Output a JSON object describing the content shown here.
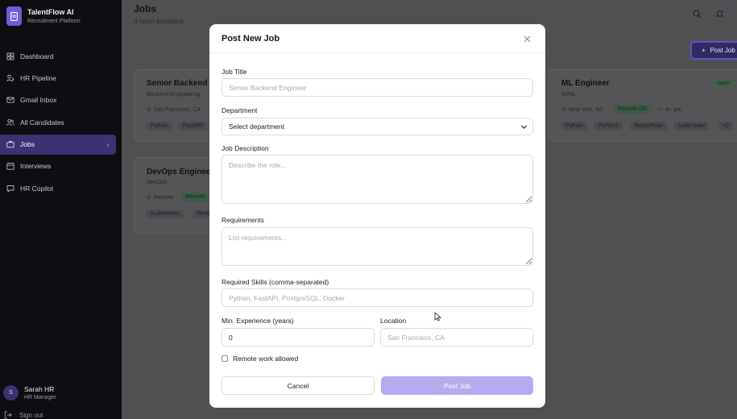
{
  "app": {
    "name": "TalentFlow AI",
    "subtitle": "Recruitment Platform"
  },
  "sidebar": {
    "items": [
      {
        "label": "Dashboard",
        "icon": "dashboard-icon"
      },
      {
        "label": "HR Pipeline",
        "icon": "pipeline-icon"
      },
      {
        "label": "Gmail Inbox",
        "icon": "mail-icon"
      },
      {
        "label": "All Candidates",
        "icon": "users-icon"
      },
      {
        "label": "Jobs",
        "icon": "briefcase-icon",
        "active": true
      },
      {
        "label": "Interviews",
        "icon": "calendar-icon"
      },
      {
        "label": "HR Copilot",
        "icon": "chat-icon"
      }
    ],
    "user": {
      "initial": "S",
      "name": "Sarah HR",
      "role": "HR Manager"
    },
    "signout": "Sign out"
  },
  "header": {
    "title": "Jobs",
    "subtitle": "4 open positions",
    "post_button": "Post Job"
  },
  "jobs": [
    {
      "title": "Senior Backend",
      "dept": "Backend Engineering",
      "location": "San Francisco, CA",
      "tags": [
        "Python",
        "FastAPI"
      ]
    },
    {
      "title": "DevOps Enginee",
      "dept": "DevOps",
      "location": "Remote",
      "remote_badge": "Remote",
      "tags": [
        "Kubernetes",
        "Terra"
      ]
    },
    {
      "title": "ML Engineer",
      "dept": "AI/ML",
      "location": "New York, NY",
      "remote_badge": "Remote OK",
      "experience": "4+ yrs",
      "status": "open",
      "tags": [
        "Python",
        "PyTorch",
        "TensorFlow",
        "scikit-learn",
        "+2"
      ]
    }
  ],
  "modal": {
    "title": "Post New Job",
    "fields": {
      "job_title": {
        "label": "Job Title",
        "placeholder": "Senior Backend Engineer"
      },
      "department": {
        "label": "Department",
        "value": "Select department"
      },
      "description": {
        "label": "Job Description",
        "placeholder": "Describe the role..."
      },
      "requirements": {
        "label": "Requirements",
        "placeholder": "List requirements..."
      },
      "skills": {
        "label": "Required Skills (comma-separated)",
        "placeholder": "Python, FastAPI, PostgreSQL, Docker"
      },
      "min_experience": {
        "label": "Min. Experience (years)",
        "value": "0"
      },
      "location": {
        "label": "Location",
        "placeholder": "San Francisco, CA"
      },
      "remote": {
        "label": "Remote work allowed",
        "checked": false
      }
    },
    "cancel_label": "Cancel",
    "submit_label": "Post Job"
  },
  "colors": {
    "accent": "#6d5ddc",
    "sidebar_bg": "#0d0d12",
    "active_nav": "#3a3272",
    "submit_disabled": "#b4acef"
  }
}
